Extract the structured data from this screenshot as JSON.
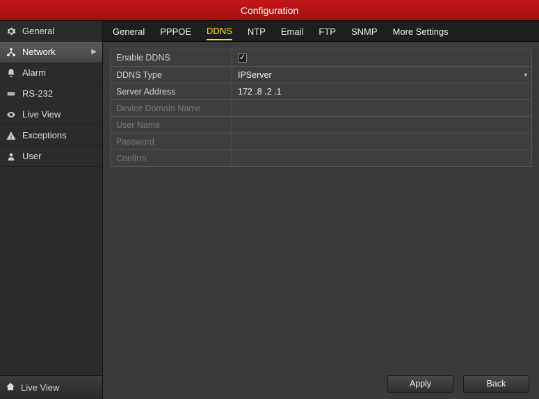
{
  "title": "Configuration",
  "sidebar": {
    "items": [
      {
        "label": "General",
        "icon": "gear",
        "active": false
      },
      {
        "label": "Network",
        "icon": "network",
        "active": true
      },
      {
        "label": "Alarm",
        "icon": "bell",
        "active": false
      },
      {
        "label": "RS-232",
        "icon": "port",
        "active": false
      },
      {
        "label": "Live View",
        "icon": "eye",
        "active": false
      },
      {
        "label": "Exceptions",
        "icon": "warning",
        "active": false
      },
      {
        "label": "User",
        "icon": "user",
        "active": false
      }
    ],
    "footer": {
      "label": "Live View",
      "icon": "home"
    }
  },
  "tabs": [
    "General",
    "PPPOE",
    "DDNS",
    "NTP",
    "Email",
    "FTP",
    "SNMP",
    "More Settings"
  ],
  "active_tab": "DDNS",
  "form": {
    "enable_label": "Enable DDNS",
    "enable_checked": true,
    "type_label": "DDNS Type",
    "type_value": "IPServer",
    "server_label": "Server Address",
    "server_value": "172 .8 .2 .1",
    "domain_label": "Device Domain Name",
    "domain_value": "",
    "user_label": "User Name",
    "user_value": "",
    "pass_label": "Password",
    "pass_value": "",
    "confirm_label": "Confirm",
    "confirm_value": ""
  },
  "buttons": {
    "apply": "Apply",
    "back": "Back"
  }
}
